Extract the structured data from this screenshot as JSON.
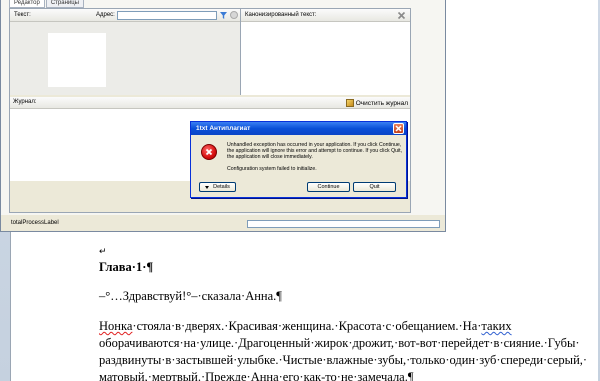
{
  "app": {
    "tabs": [
      "Редактор",
      "Страницы"
    ],
    "text_label": "Текст:",
    "address_label": "Адрес:",
    "address_value": "",
    "canonical_label": "Канонизированный текст:",
    "journal_label": "Журнал:",
    "clear_journal_label": "Очистить журнал",
    "status_label": "totalProcessLabel",
    "progress": 0
  },
  "dialog": {
    "title": "1txt Антиплагиат",
    "message": "Unhandled exception has occurred in your application. If you click Continue, the application will ignore this error and attempt to continue. If you click Quit, the application will close immediately.",
    "sub_message": "Configuration system failed to initialize.",
    "details_label": "Details",
    "continue_label": "Continue",
    "quit_label": "Quit",
    "icon": "error-icon"
  },
  "document": {
    "mark": "↵",
    "heading": "Глава·1·¶",
    "line1": "–°…Здравствуй!°–·сказала·Анна.¶",
    "para_parts": [
      "Нонка",
      "·стояла·в·дверях.·Красивая·женщина.·Красота·с·обещанием.·На·",
      "таких"
    ],
    "para_line2": "оборачиваются·на·улице.·Драгоценный·жирок·дрожит,·вот-вот·перейдет·в·сияние.·Губы·",
    "para_line3": "раздвинуты·в·застывшей·улыбке.·Чистые·влажные·зубы,·только·один·зуб·спереди·серый,·",
    "para_line4": "матовый,·мертвый.·Прежде·Анна·его·как-то·не·замечала.¶"
  },
  "colors": {
    "titlebar": "#0a50d8",
    "error_red": "#d61010",
    "spell_underline": "#e02020"
  }
}
